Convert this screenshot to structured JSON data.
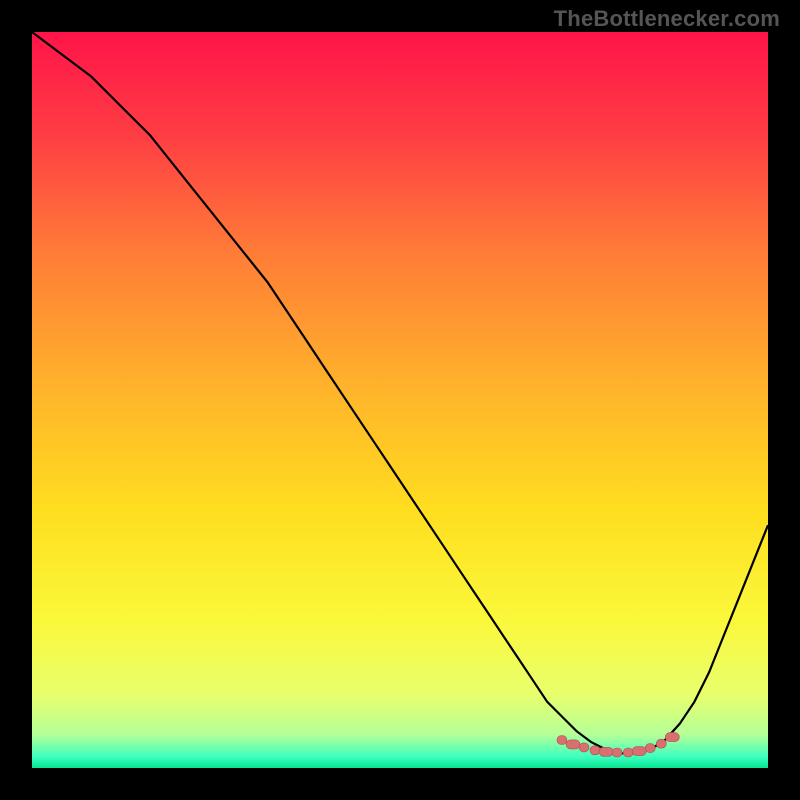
{
  "attribution": "TheBottlenecker.com",
  "colors": {
    "frame_bg": "#000000",
    "gradient_stops": [
      {
        "offset": 0.0,
        "color": "#ff1449"
      },
      {
        "offset": 0.14,
        "color": "#ff3d44"
      },
      {
        "offset": 0.3,
        "color": "#ff7c37"
      },
      {
        "offset": 0.48,
        "color": "#ffb22b"
      },
      {
        "offset": 0.65,
        "color": "#ffde1f"
      },
      {
        "offset": 0.8,
        "color": "#fbf83b"
      },
      {
        "offset": 0.9,
        "color": "#e8ff6d"
      },
      {
        "offset": 0.955,
        "color": "#b4ff98"
      },
      {
        "offset": 0.985,
        "color": "#3dffc0"
      },
      {
        "offset": 1.0,
        "color": "#06e58e"
      }
    ],
    "curve": "#000000",
    "marker_fill": "#d87070",
    "marker_stroke": "#b24f4f",
    "attribution_text": "#555555"
  },
  "chart_data": {
    "type": "line",
    "title": "",
    "xlabel": "",
    "ylabel": "",
    "xlim": [
      0,
      100
    ],
    "ylim": [
      0,
      100
    ],
    "grid": false,
    "legend": false,
    "series": [
      {
        "name": "bottleneck-curve",
        "x": [
          0,
          4,
          8,
          12,
          16,
          20,
          24,
          28,
          32,
          36,
          40,
          44,
          48,
          52,
          56,
          58,
          60,
          62,
          64,
          66,
          68,
          70,
          72,
          74,
          76,
          78,
          80,
          82,
          84,
          86,
          88,
          90,
          92,
          94,
          96,
          98,
          100
        ],
        "y": [
          100,
          97,
          94,
          90,
          86,
          81,
          76,
          71,
          66,
          60,
          54,
          48,
          42,
          36,
          30,
          27,
          24,
          21,
          18,
          15,
          12,
          9,
          7,
          5,
          3.5,
          2.5,
          2,
          2,
          2.5,
          3.8,
          6,
          9,
          13,
          18,
          23,
          28,
          33
        ]
      }
    ],
    "markers": {
      "name": "bottleneck-band-dots",
      "x": [
        72,
        73.5,
        75,
        76.5,
        78,
        79.5,
        81,
        82.5,
        84,
        85.5,
        87
      ],
      "y": [
        3.8,
        3.2,
        2.8,
        2.4,
        2.2,
        2.1,
        2.1,
        2.3,
        2.7,
        3.3,
        4.2
      ]
    }
  }
}
